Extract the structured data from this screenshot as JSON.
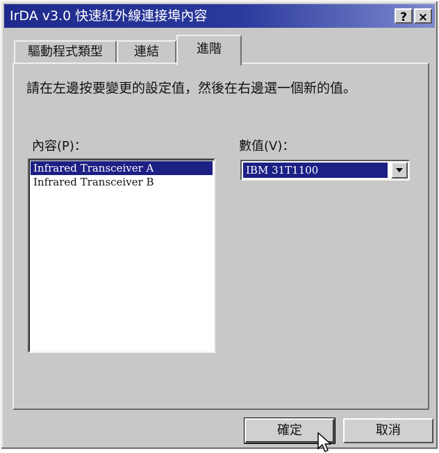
{
  "window": {
    "title": "IrDA v3.0 快速紅外線連接埠內容",
    "help_label": "?",
    "close_label": "×"
  },
  "tabs": [
    {
      "label": "驅動程式類型"
    },
    {
      "label": "連結"
    },
    {
      "label": "進階"
    }
  ],
  "active_tab": "進階",
  "instruction": "請在左邊按要變更的設定值，然後在右邊選一個新的值。",
  "property": {
    "label": "內容(P)：",
    "items": [
      {
        "label": "Infrared Transceiver A",
        "selected": true
      },
      {
        "label": "Infrared Transceiver B",
        "selected": false
      }
    ]
  },
  "value": {
    "label": "數值(V)：",
    "selected": "IBM 31T1100"
  },
  "buttons": {
    "ok": "確定",
    "cancel": "取消"
  },
  "colors": {
    "titlebar": "#1f2a8c",
    "selection": "#1c1f84",
    "face": "#c8c8c8"
  }
}
